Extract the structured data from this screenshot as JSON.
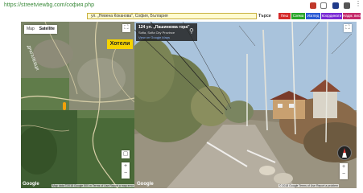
{
  "browser": {
    "url": "https://streetviewbg.com/софия.php",
    "icons": [
      "warning-icon",
      "star-icon",
      "extension-icon",
      "account-icon"
    ]
  },
  "toolbar": {
    "search_value": "ул. „Невена Коканова\", София, България",
    "go_label": "Търси",
    "map_buttons": [
      {
        "label": "Пеш",
        "color": "#d42a2a"
      },
      {
        "label": "Схема",
        "color": "#2aa52a"
      },
      {
        "label": "Изглед",
        "color": "#2a5ad4"
      },
      {
        "label": "Координати",
        "color": "#7a2ad4"
      },
      {
        "label": "Надм. височина",
        "color": "#c42a6a"
      }
    ]
  },
  "map": {
    "type_map": "Map",
    "type_satellite": "Satellite",
    "hotels_label": "Хотели",
    "google_logo": "Google",
    "footer": "Map data ©2018 Google   500 m   Terms of Use   Report a map error"
  },
  "streetview": {
    "title": "124 ул. „Пашинкова гора\"",
    "subtitle": "Sofia, Sofia City Province",
    "link": "View on Google Maps",
    "google_logo": "Google",
    "footer": "© 2018 Google   Terms of Use   Report a problem"
  }
}
